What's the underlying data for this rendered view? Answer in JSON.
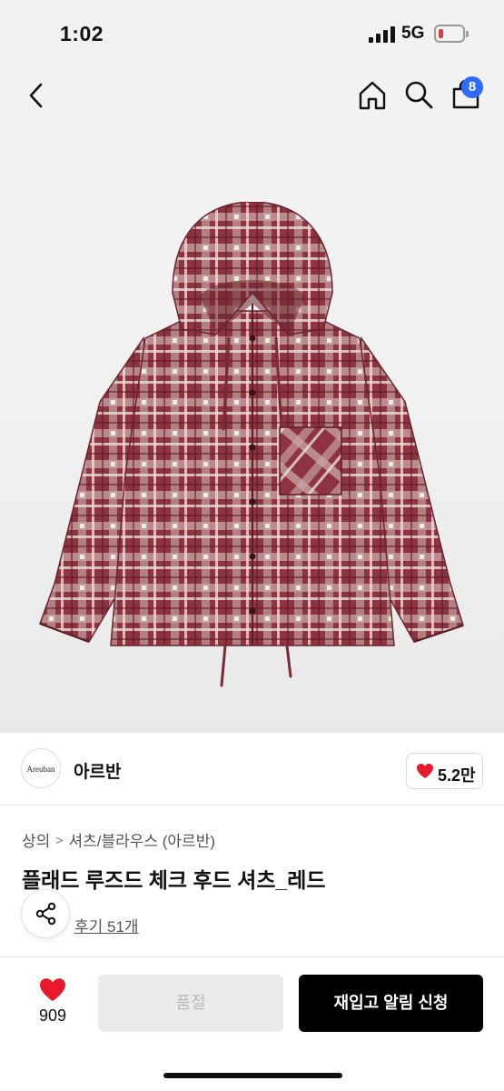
{
  "status_bar": {
    "time": "1:02",
    "network": "5G",
    "battery_color": "#e53935"
  },
  "nav": {
    "back_icon": "chevron-left-icon",
    "home_icon": "home-icon",
    "search_icon": "search-icon",
    "cart_icon": "shopping-bag-icon",
    "cart_count": "8",
    "badge_color": "#2f6bff"
  },
  "product_image": {
    "icon": "hooded-plaid-shirt-image",
    "primary_color": "#8c2f39"
  },
  "brand": {
    "logo_text": "Areuban",
    "name": "아르반",
    "likes": "5.2만",
    "like_icon": "heart-icon"
  },
  "breadcrumb": {
    "items": [
      "상의",
      "셔츠/블라우스 (아르반)"
    ],
    "separator": ">"
  },
  "product": {
    "title": "플래드 루즈드 체크 후드 셔츠_레드",
    "review_link": "후기 51개",
    "share_icon": "share-icon"
  },
  "bottom_bar": {
    "wish_count": "909",
    "soldout_label": "품절",
    "restock_label": "재입고 알림 신청",
    "accent_color": "#e8192c"
  }
}
